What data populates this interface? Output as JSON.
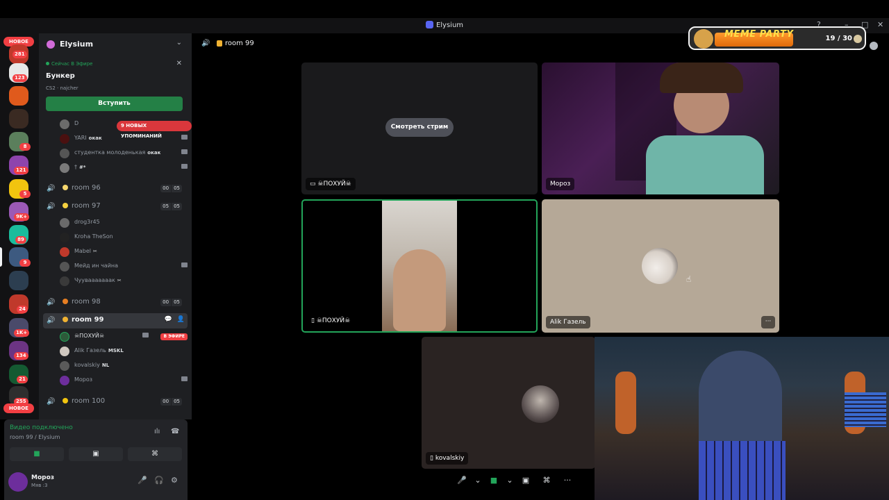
{
  "window": {
    "title": "Elysium"
  },
  "rail": {
    "new_top": "НОВОЕ",
    "new_bottom": "НОВОЕ",
    "badges": [
      "281",
      "123",
      "8",
      "121",
      "5",
      "9K+",
      "89",
      "9",
      "24",
      "1K+",
      "134",
      "21",
      "255"
    ]
  },
  "server": {
    "name": "Elysium"
  },
  "live": {
    "label": "Сейчас В Эфире",
    "channel": "Бункер",
    "meta": "CS2 · najcher",
    "join_label": "Вступить"
  },
  "mentions": {
    "label": "9 НОВЫХ УПОМИНАНИЙ"
  },
  "top_users": [
    {
      "name": "D",
      "tag": ""
    },
    {
      "name": "YARI",
      "tag": "окак"
    },
    {
      "name": "студентка молоденькая",
      "tag": "окак"
    },
    {
      "name": "†",
      "tag": "#*"
    }
  ],
  "channels": {
    "room96": {
      "name": "room 96",
      "count_a": "00",
      "count_b": "05"
    },
    "room97": {
      "name": "room 97",
      "count_a": "05",
      "count_b": "05"
    },
    "room98": {
      "name": "room 98",
      "count_a": "00",
      "count_b": "05"
    },
    "room99": {
      "name": "room 99"
    },
    "room100": {
      "name": "room 100",
      "count_a": "00",
      "count_b": "05"
    }
  },
  "room97_users": [
    {
      "name": "drog3r45",
      "tag": ""
    },
    {
      "name": "Kroha TheSon",
      "tag": ""
    },
    {
      "name": "Mabel",
      "tag": "✂︎"
    },
    {
      "name": "Мейд ин чайна",
      "tag": ""
    },
    {
      "name": "Чуувааааааак",
      "tag": "✂︎"
    }
  ],
  "room99_users": [
    {
      "name": "☠ПОХУЙ☠",
      "tag": ""
    },
    {
      "name": "Alik Газель",
      "tag": "MSKL"
    },
    {
      "name": "kovalskiy",
      "tag": "NL"
    },
    {
      "name": "Мороз",
      "tag": ""
    }
  ],
  "live_badge": "В ЭФИРЕ",
  "voice": {
    "status": "Видео подключено",
    "location": "room 99 / Elysium"
  },
  "user": {
    "name": "Мороз",
    "status": "Мяв :3"
  },
  "main": {
    "room_name": "room 99",
    "watch_label": "Смотреть стрим",
    "tiles": {
      "stream": "☠ПОХУЙ☠",
      "moroz": "Мороз",
      "cam": "☠ПОХУЙ☠",
      "alik": "Alik Газель",
      "koval": "kovalskiy"
    }
  },
  "widget": {
    "title": "MEME PARTY",
    "count": "19 / 30",
    "progress": 0.63
  },
  "colors": {
    "accent_green": "#248046",
    "live_red": "#f23f43",
    "speaking_border": "#23a55a"
  }
}
